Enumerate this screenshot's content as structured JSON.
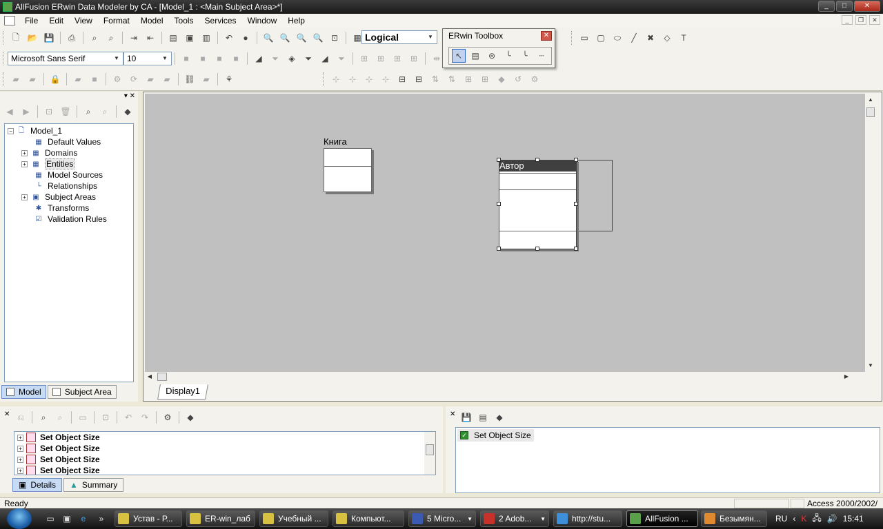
{
  "window": {
    "title": "AllFusion ERwin Data Modeler by CA - [Model_1 : <Main Subject Area>*]",
    "controls": {
      "minimize": "_",
      "maximize": "□",
      "close": "✕"
    }
  },
  "menu": [
    "File",
    "Edit",
    "View",
    "Format",
    "Model",
    "Tools",
    "Services",
    "Window",
    "Help"
  ],
  "toolbar": {
    "view_mode": "Logical",
    "font_name": "Microsoft Sans Serif",
    "font_size": "10"
  },
  "toolbox": {
    "title": "ERwin Toolbox",
    "close": "✕"
  },
  "tree": {
    "root": "Model_1",
    "items": [
      "Default Values",
      "Domains",
      "Entities",
      "Model Sources",
      "Relationships",
      "Subject Areas",
      "Transforms",
      "Validation Rules"
    ]
  },
  "left_tabs": [
    "Model",
    "Subject Area"
  ],
  "diagram": {
    "tab": "Display1",
    "entities": [
      {
        "name": "Книга",
        "selected": false
      },
      {
        "name": "Автор",
        "selected": true
      }
    ]
  },
  "action_log": {
    "rows": [
      "Set Object Size",
      "Set Object Size",
      "Set Object Size",
      "Set Object Size"
    ],
    "tabs": [
      "Details",
      "Summary"
    ]
  },
  "details": {
    "row": "Set Object Size"
  },
  "status": {
    "text": "Ready",
    "db": "Access 2000/2002/"
  },
  "taskbar": {
    "tasks": [
      "Устав - Р...",
      "ER-win_лаб",
      "Учебный ...",
      "Компьют...",
      "5 Micro...",
      "2 Adob...",
      "http://stu...",
      "AllFusion ...",
      "Безымян..."
    ],
    "lang": "RU",
    "clock": "15:41"
  }
}
